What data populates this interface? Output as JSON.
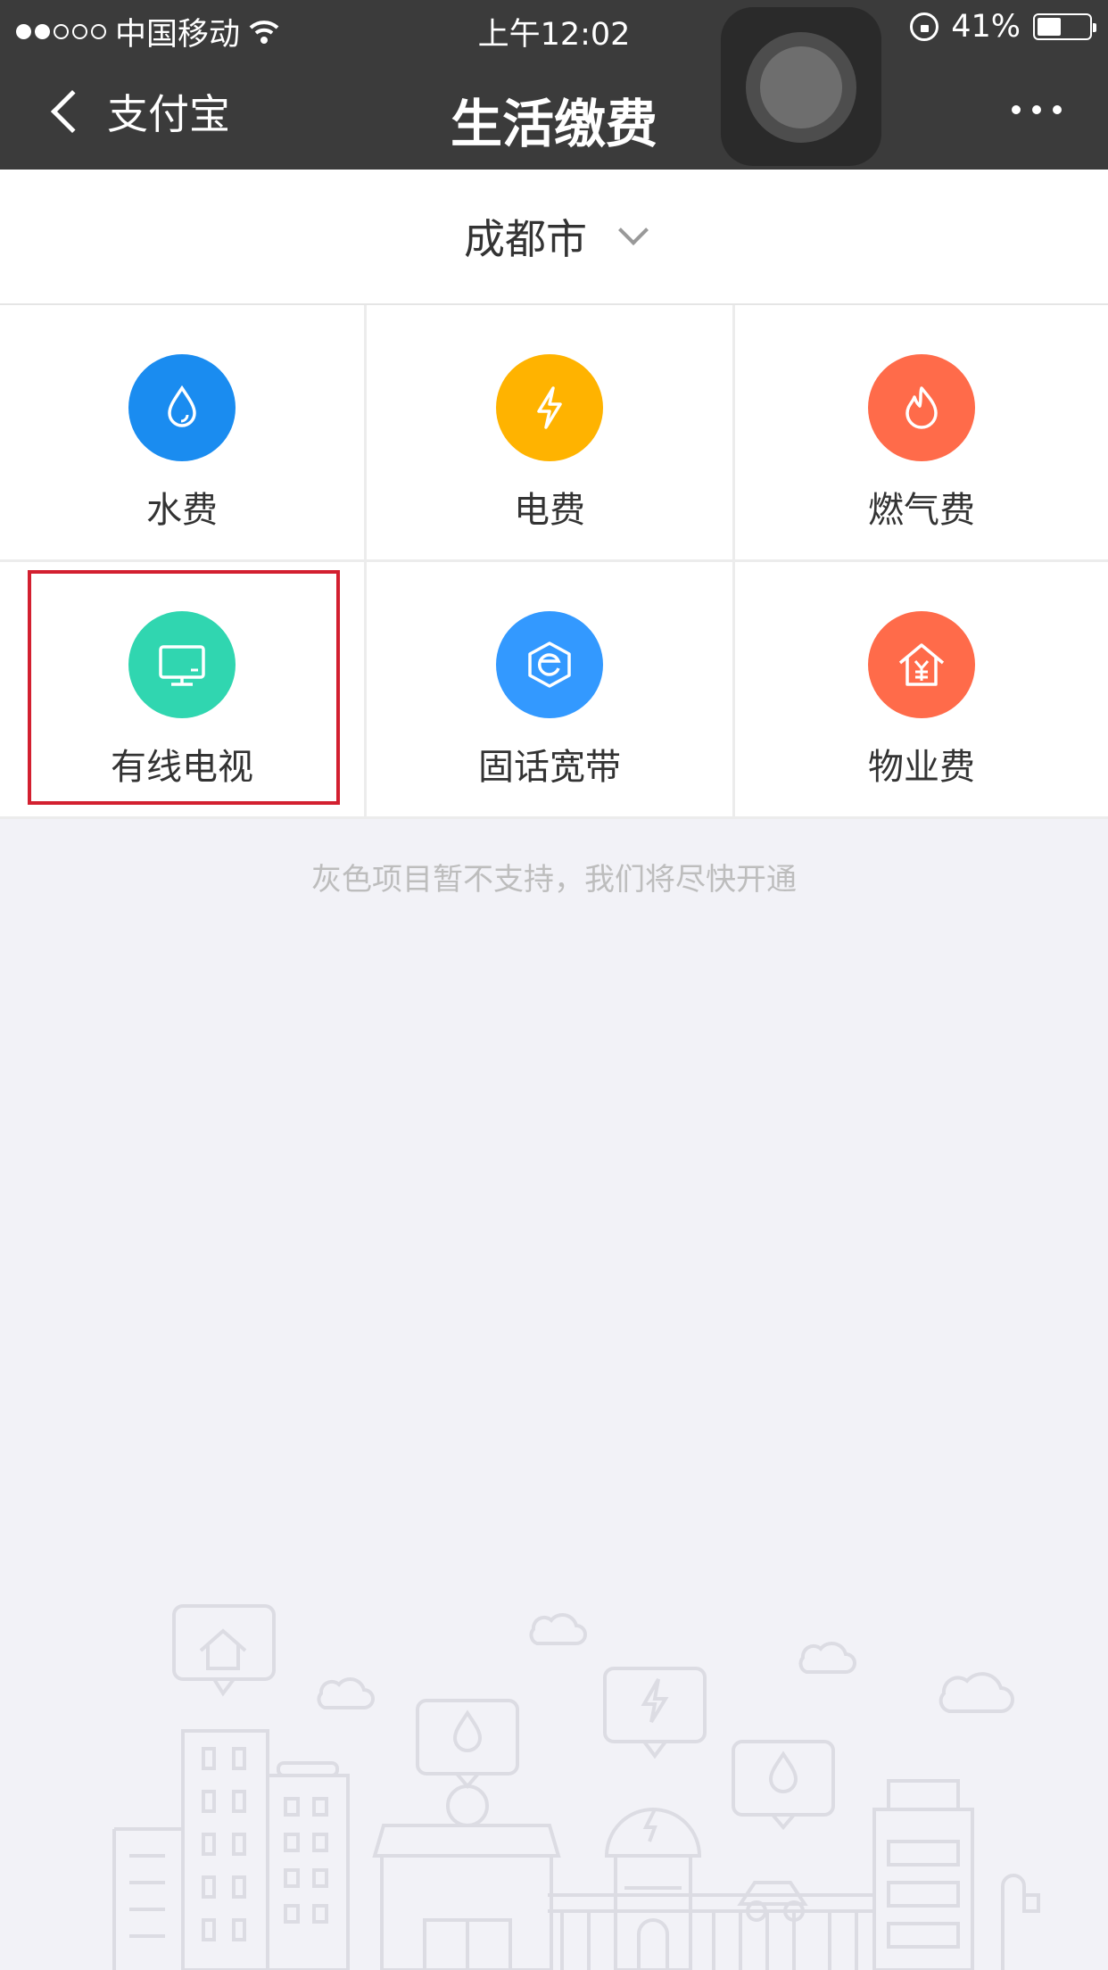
{
  "status_bar": {
    "carrier": "中国移动",
    "time": "上午12:02",
    "battery": "41%",
    "signal_dots": 5,
    "signal_filled": 2
  },
  "nav": {
    "back_label": "支付宝",
    "title": "生活缴费"
  },
  "city": {
    "name": "成都市"
  },
  "services": [
    {
      "label": "水费",
      "icon": "water-drop-icon",
      "color": "#1a8cf0"
    },
    {
      "label": "电费",
      "icon": "lightning-icon",
      "color": "#ffb300"
    },
    {
      "label": "燃气费",
      "icon": "flame-icon",
      "color": "#ff6b4a"
    },
    {
      "label": "有线电视",
      "icon": "tv-icon",
      "color": "#30d6b0"
    },
    {
      "label": "固话宽带",
      "icon": "broadband-icon",
      "color": "#3399ff"
    },
    {
      "label": "物业费",
      "icon": "house-yen-icon",
      "color": "#ff6b4a"
    }
  ],
  "notice": "灰色项目暂不支持，我们将尽快开通"
}
